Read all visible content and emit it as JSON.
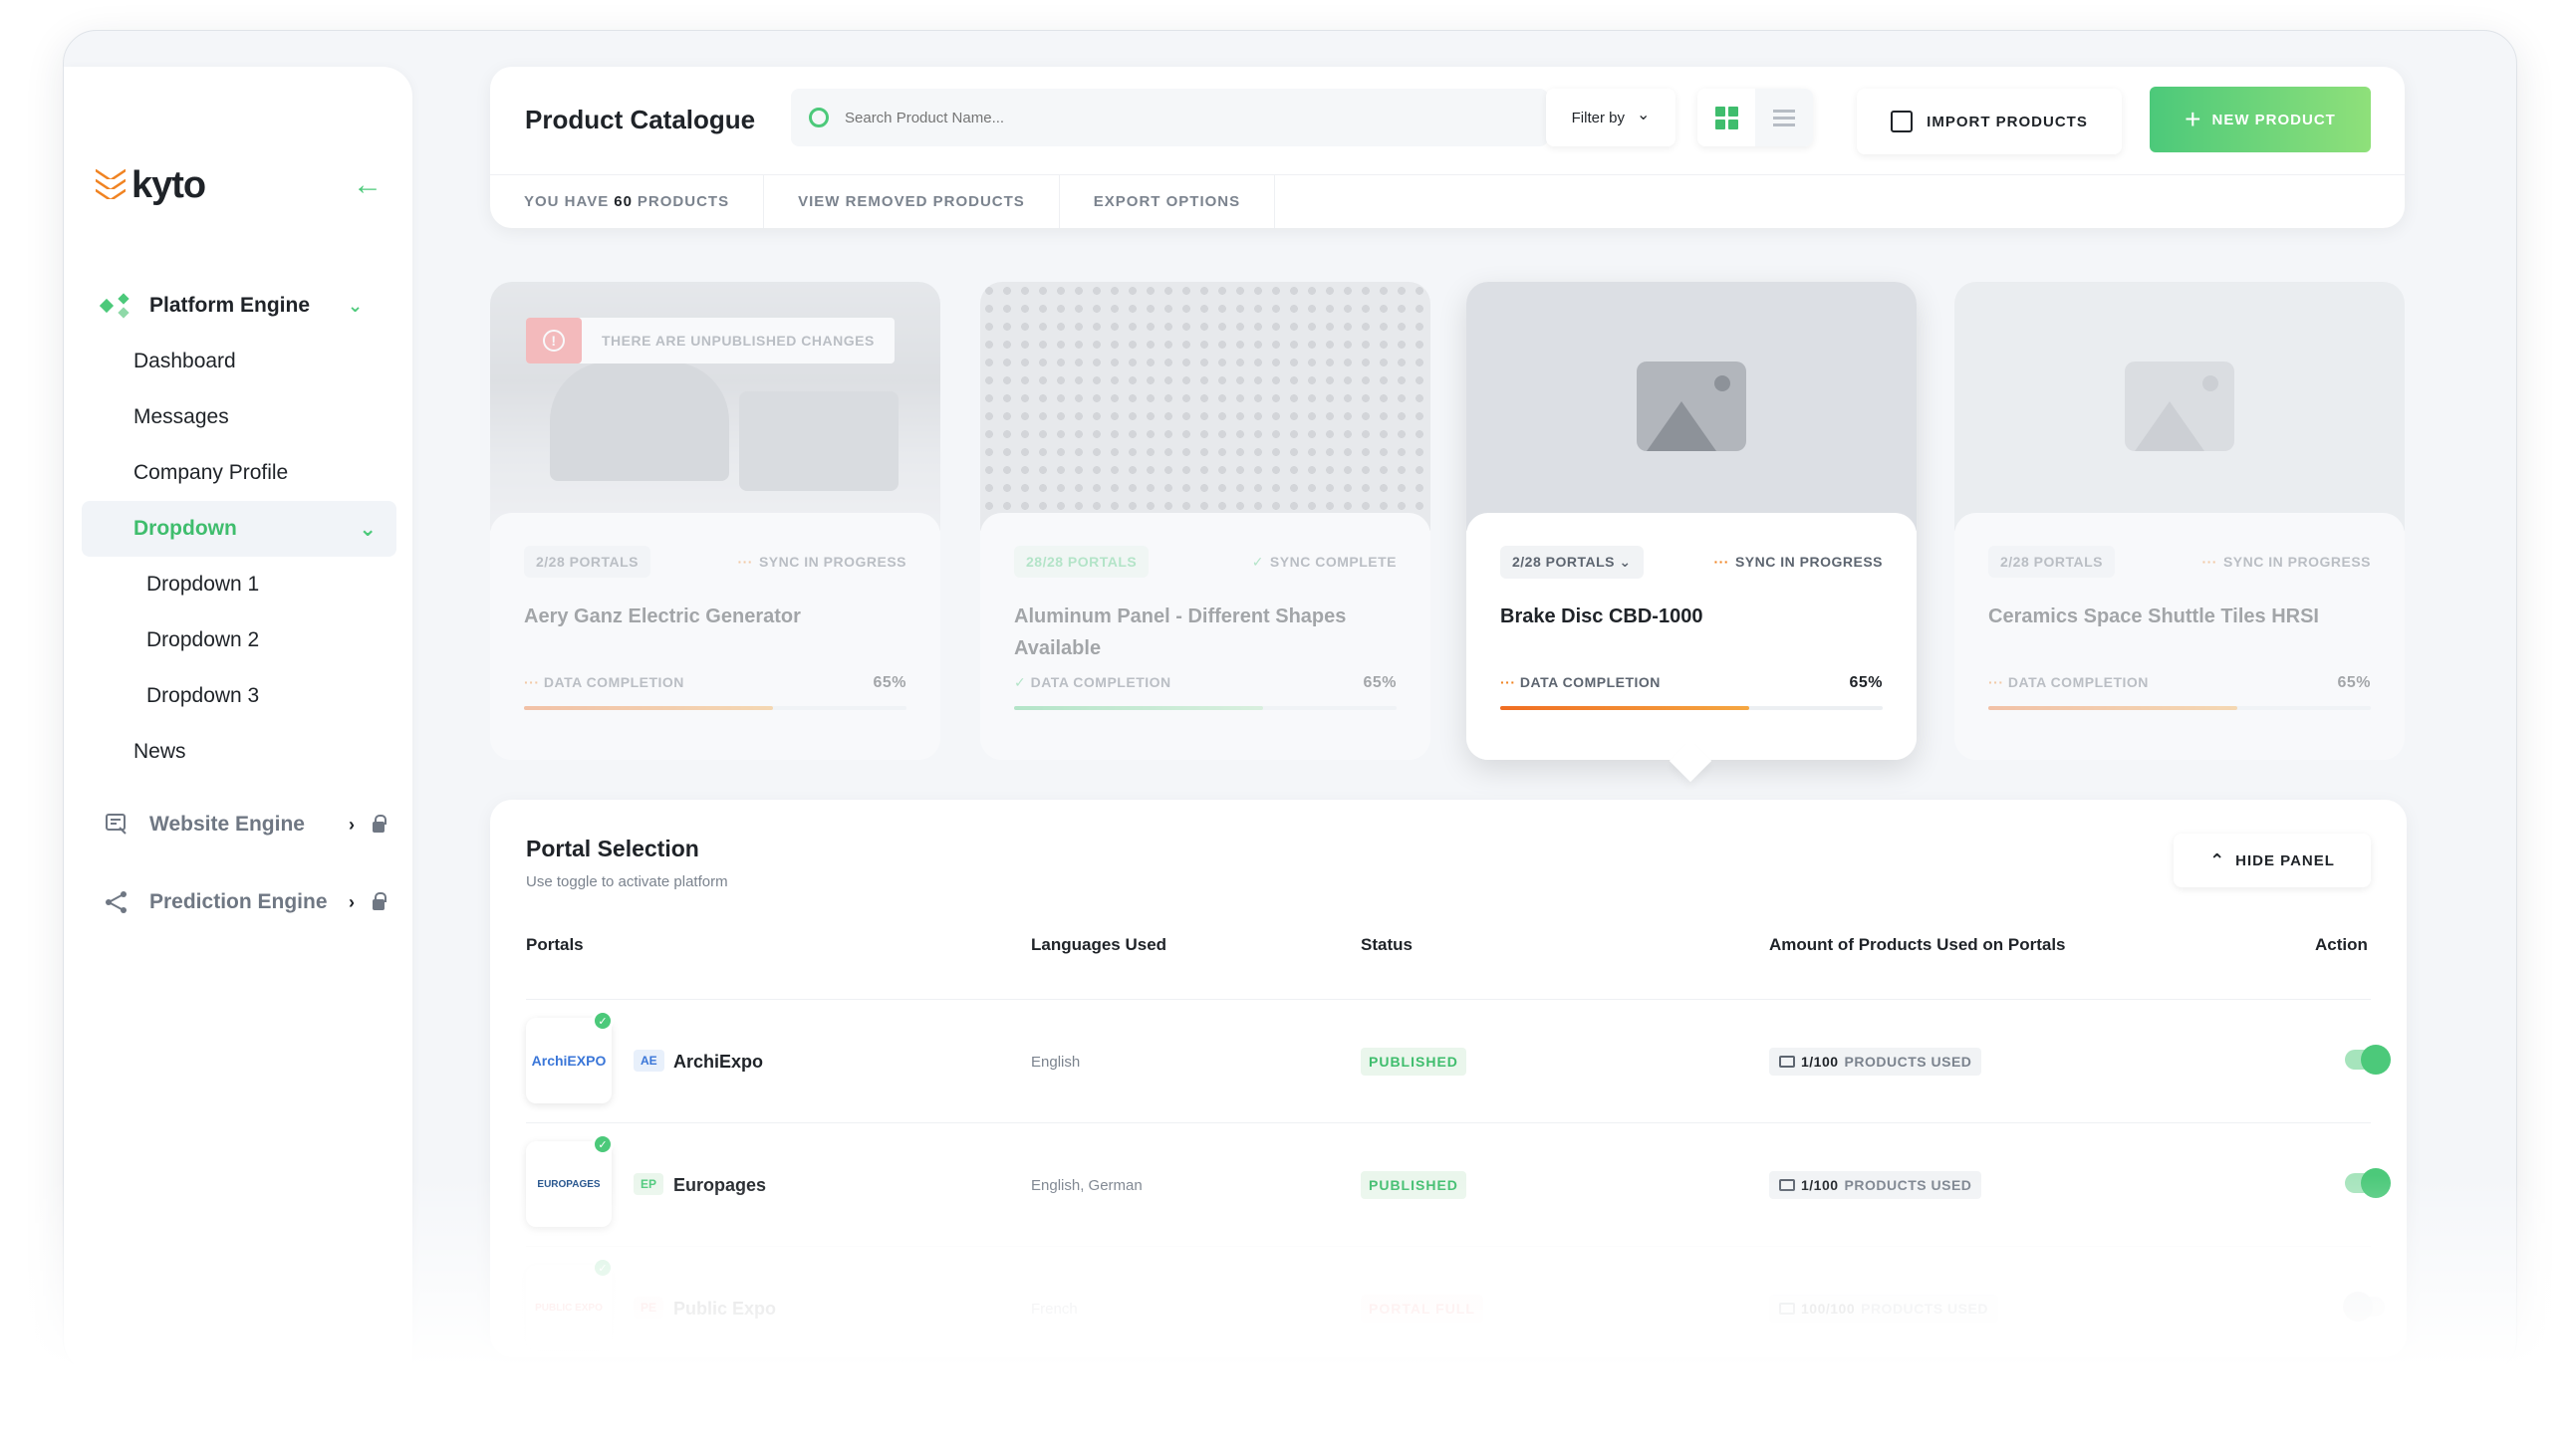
{
  "app": {
    "logo": "kyto"
  },
  "sidebar": {
    "sections": {
      "platform": {
        "label": "Platform Engine"
      },
      "website": {
        "label": "Website Engine"
      },
      "prediction": {
        "label": "Prediction Engine"
      }
    },
    "items": [
      {
        "label": "Dashboard"
      },
      {
        "label": "Messages"
      },
      {
        "label": "Company Profile"
      },
      {
        "label": "Dropdown"
      },
      {
        "label": "Dropdown 1"
      },
      {
        "label": "Dropdown 2"
      },
      {
        "label": "Dropdown 3"
      },
      {
        "label": "News"
      }
    ]
  },
  "header": {
    "title": "Product Catalogue",
    "search_placeholder": "Search Product Name...",
    "filter_label": "Filter by",
    "import_label": "IMPORT PRODUCTS",
    "new_label": "NEW PRODUCT",
    "tabs": {
      "count_prefix": "YOU HAVE",
      "count": "60",
      "count_suffix": "PRODUCTS",
      "removed": "VIEW REMOVED PRODUCTS",
      "export": "EXPORT OPTIONS"
    }
  },
  "products": [
    {
      "portals": "2/28 PORTALS",
      "sync": "SYNC IN PROGRESS",
      "name": "Aery Ganz Electric Generator",
      "dc_label": "DATA COMPLETION",
      "pct": "65%",
      "completion": 0.65,
      "notice": "THERE ARE UNPUBLISHED CHANGES"
    },
    {
      "portals": "28/28 PORTALS",
      "sync": "SYNC COMPLETE",
      "name": "Aluminum Panel - Different Shapes Available",
      "dc_label": "DATA COMPLETION",
      "pct": "65%",
      "completion": 0.65
    },
    {
      "portals": "2/28 PORTALS",
      "sync": "SYNC IN PROGRESS",
      "name": "Brake Disc CBD-1000",
      "dc_label": "DATA COMPLETION",
      "pct": "65%",
      "completion": 0.65
    },
    {
      "portals": "2/28 PORTALS",
      "sync": "SYNC IN PROGRESS",
      "name": "Ceramics Space Shuttle Tiles HRSI",
      "dc_label": "DATA COMPLETION",
      "pct": "65%",
      "completion": 0.65
    }
  ],
  "panel": {
    "title": "Portal Selection",
    "subtitle": "Use toggle to activate platform",
    "hide_label": "HIDE PANEL",
    "columns": {
      "portals": "Portals",
      "languages": "Languages Used",
      "status": "Status",
      "amount": "Amount of Products Used on Portals",
      "action": "Action"
    },
    "rows": [
      {
        "logo": "ArchiEXPO",
        "abbr": "AE",
        "name": "ArchiExpo",
        "languages": "English",
        "status": "PUBLISHED",
        "used": "1/100",
        "used_label": "PRODUCTS USED",
        "active": true
      },
      {
        "logo": "EUROPAGES",
        "abbr": "EP",
        "name": "Europages",
        "languages": "English, German",
        "status": "PUBLISHED",
        "used": "1/100",
        "used_label": "PRODUCTS USED",
        "active": true
      },
      {
        "logo": "PUBLIC EXPO",
        "abbr": "PE",
        "name": "Public Expo",
        "languages": "French",
        "status": "PORTAL FULL",
        "used": "100/100",
        "used_label": "PRODUCTS USED",
        "active": false
      }
    ]
  },
  "colors": {
    "accent": "#4cc97a",
    "warning": "#f08322",
    "danger": "#f25a5a"
  }
}
